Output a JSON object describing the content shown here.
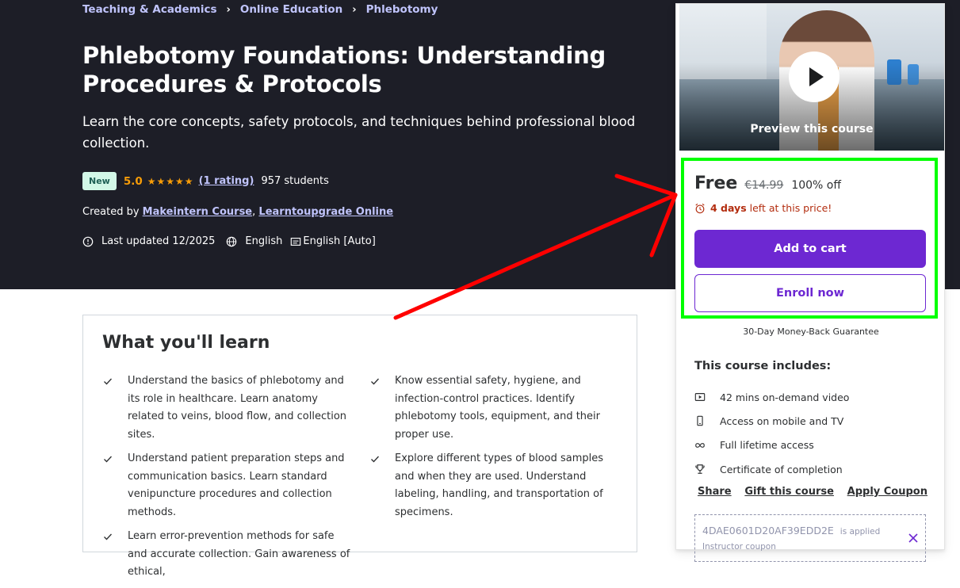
{
  "breadcrumb": [
    "Teaching & Academics",
    "Online Education",
    "Phlebotomy"
  ],
  "course": {
    "title": "Phlebotomy Foundations: Understanding Procedures & Protocols",
    "subtitle": "Learn the core concepts, safety protocols, and techniques behind professional blood collection.",
    "badge": "New",
    "rating": "5.0",
    "stars": "★★★★★",
    "rating_count": "(1 rating)",
    "students": "957 students",
    "created_by_label": "Created by",
    "instructors": [
      "Makeintern Course",
      "Learntoupgrade Online"
    ],
    "instructor_separator": ",",
    "last_updated": "Last updated 12/2025",
    "language": "English",
    "captions": "English [Auto]"
  },
  "learn": {
    "heading": "What you'll learn",
    "left": [
      "Understand the basics of phlebotomy and its role in healthcare. Learn anatomy related to veins, blood flow, and collection sites.",
      "Understand patient preparation steps and communication basics. Learn standard venipuncture procedures and collection methods.",
      "Learn error-prevention methods for safe and accurate collection. Gain awareness of ethical,"
    ],
    "right": [
      "Know essential safety, hygiene, and infection-control practices. Identify phlebotomy tools, equipment, and their proper use.",
      "Explore different types of blood samples and when they are used. Understand labeling, handling, and transportation of specimens."
    ]
  },
  "sidebar": {
    "preview_label": "Preview this course",
    "price": "Free",
    "original_price": "€14.99",
    "discount": "100% off",
    "timer_bold": "4 days",
    "timer_rest": "left at this price!",
    "add_to_cart": "Add to cart",
    "enroll": "Enroll now",
    "guarantee": "30-Day Money-Back Guarantee",
    "includes_title": "This course includes:",
    "includes": [
      {
        "icon": "video-icon",
        "text": "42 mins on-demand video"
      },
      {
        "icon": "mobile-icon",
        "text": "Access on mobile and TV"
      },
      {
        "icon": "infinity-icon",
        "text": "Full lifetime access"
      },
      {
        "icon": "trophy-icon",
        "text": "Certificate of completion"
      }
    ],
    "links": [
      "Share",
      "Gift this course",
      "Apply Coupon"
    ],
    "coupon_code": "4DAE0601D20AF39EDD2E",
    "coupon_applied": "is applied",
    "coupon_sub": "Instructor coupon"
  },
  "colors": {
    "hero_bg": "#1d1e27",
    "accent_purple": "#6d28d2",
    "link_lavender": "#c0c4fc",
    "star_orange": "#f69c08",
    "timer_red": "#b32d0f",
    "highlight_green": "#00ff00",
    "arrow_red": "#ff0000"
  }
}
